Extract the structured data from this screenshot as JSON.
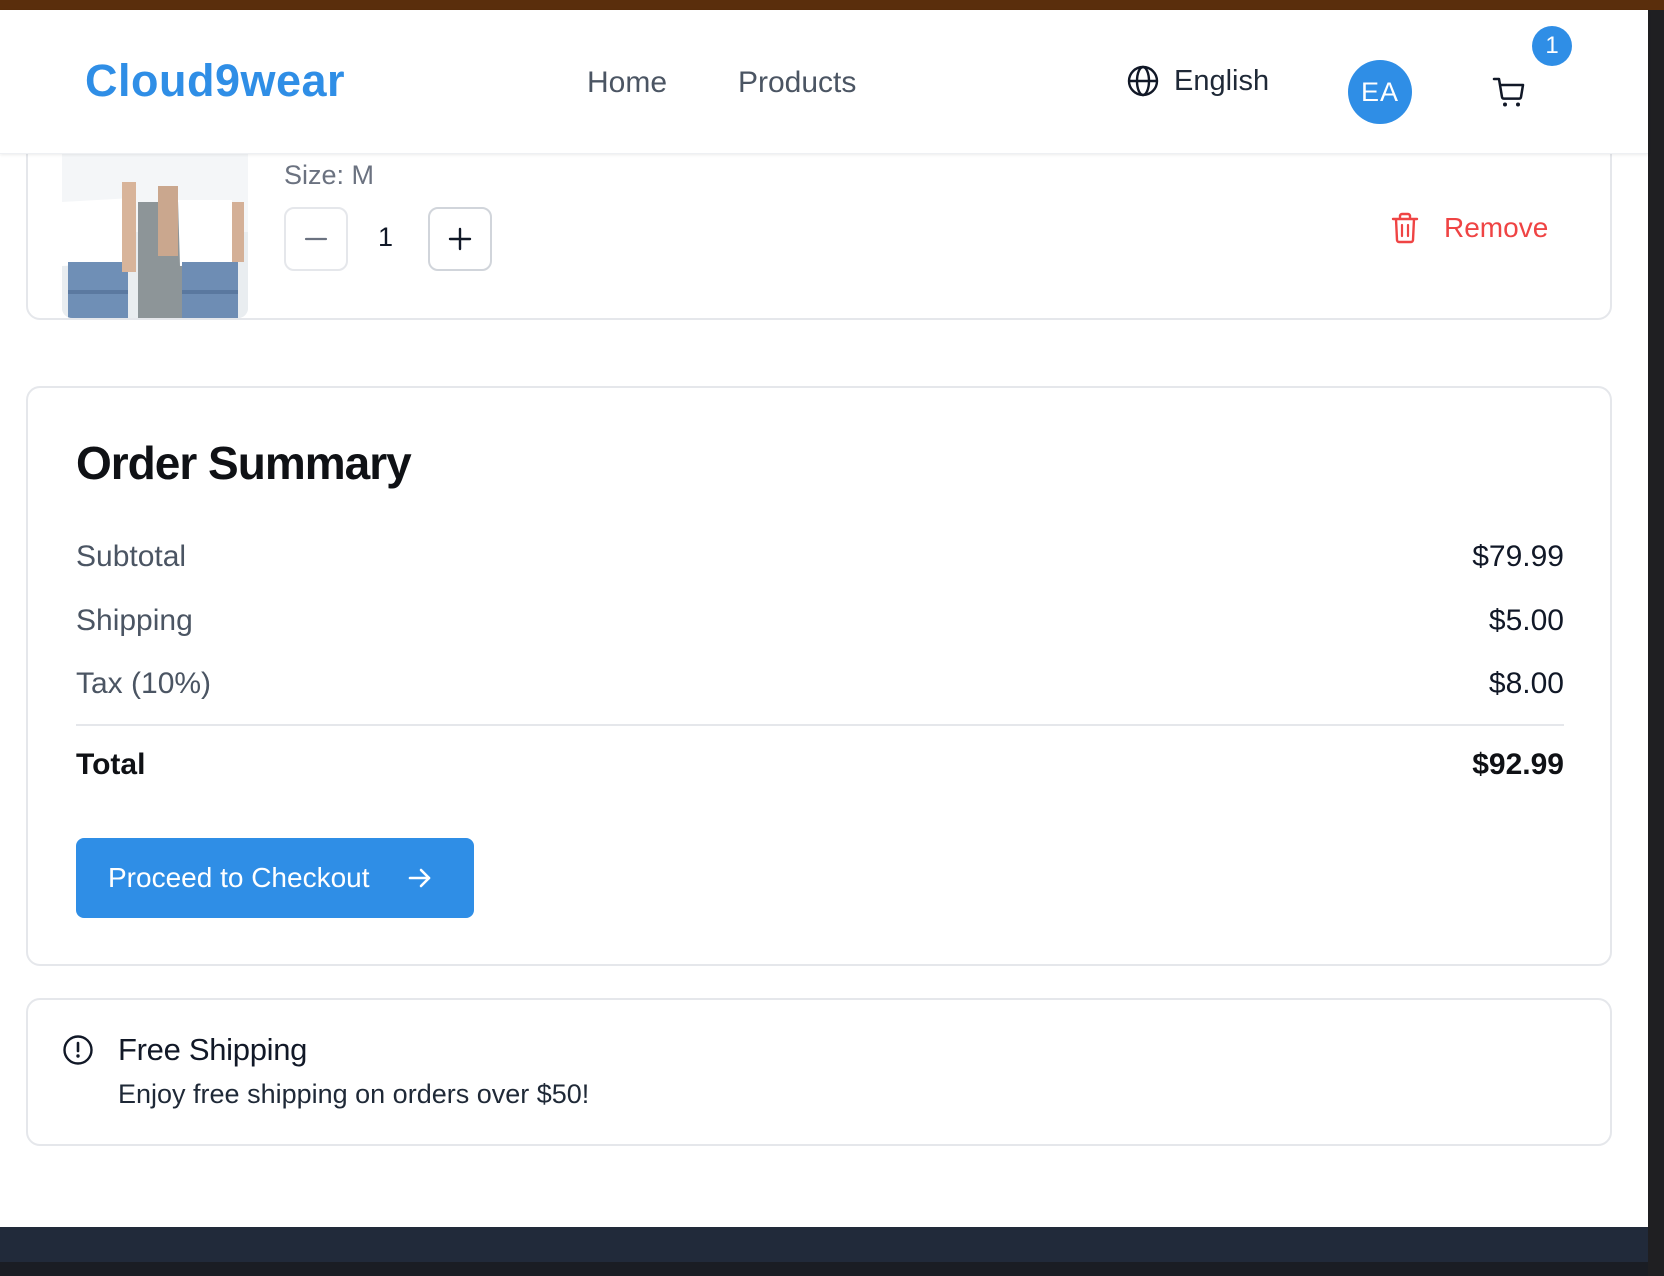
{
  "header": {
    "logo": "Cloud9wear",
    "nav": {
      "home": "Home",
      "products": "Products"
    },
    "language": "English",
    "avatar_initials": "EA",
    "cart_count": "1"
  },
  "cart_item": {
    "size_label": "Size: M",
    "quantity": "1",
    "remove_label": "Remove"
  },
  "summary": {
    "title": "Order Summary",
    "subtotal_label": "Subtotal",
    "subtotal_value": "$79.99",
    "shipping_label": "Shipping",
    "shipping_value": "$5.00",
    "tax_label": "Tax (10%)",
    "tax_value": "$8.00",
    "total_label": "Total",
    "total_value": "$92.99",
    "checkout_label": "Proceed to Checkout"
  },
  "promo": {
    "title": "Free Shipping",
    "text": "Enjoy free shipping on orders over $50!"
  },
  "colors": {
    "brand": "#2f8ee6",
    "danger": "#ef4444",
    "footer": "#212a3a"
  },
  "icons": [
    "globe-icon",
    "cart-icon",
    "minus-icon",
    "plus-icon",
    "trash-icon",
    "arrow-right-icon",
    "alert-circle-icon"
  ]
}
